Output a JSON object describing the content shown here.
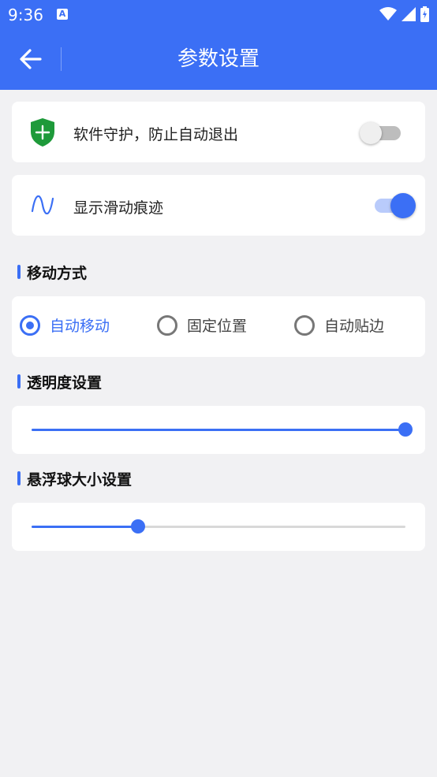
{
  "status_bar": {
    "time": "9:36",
    "notification_icon": "A"
  },
  "header": {
    "title": "参数设置"
  },
  "settings": {
    "guard": {
      "label": "软件守护，防止自动退出",
      "enabled": false
    },
    "trail": {
      "label": "显示滑动痕迹",
      "enabled": true
    }
  },
  "move_mode": {
    "title": "移动方式",
    "options": [
      {
        "label": "自动移动",
        "selected": true
      },
      {
        "label": "固定位置",
        "selected": false
      },
      {
        "label": "自动贴边",
        "selected": false
      }
    ]
  },
  "transparency": {
    "title": "透明度设置",
    "value_fraction": 1.0
  },
  "ball_size": {
    "title": "悬浮球大小设置",
    "value_fraction": 0.285
  },
  "colors": {
    "accent": "#3b6ff5",
    "shield_green": "#1e9a3a",
    "background": "#f1f1f3"
  }
}
